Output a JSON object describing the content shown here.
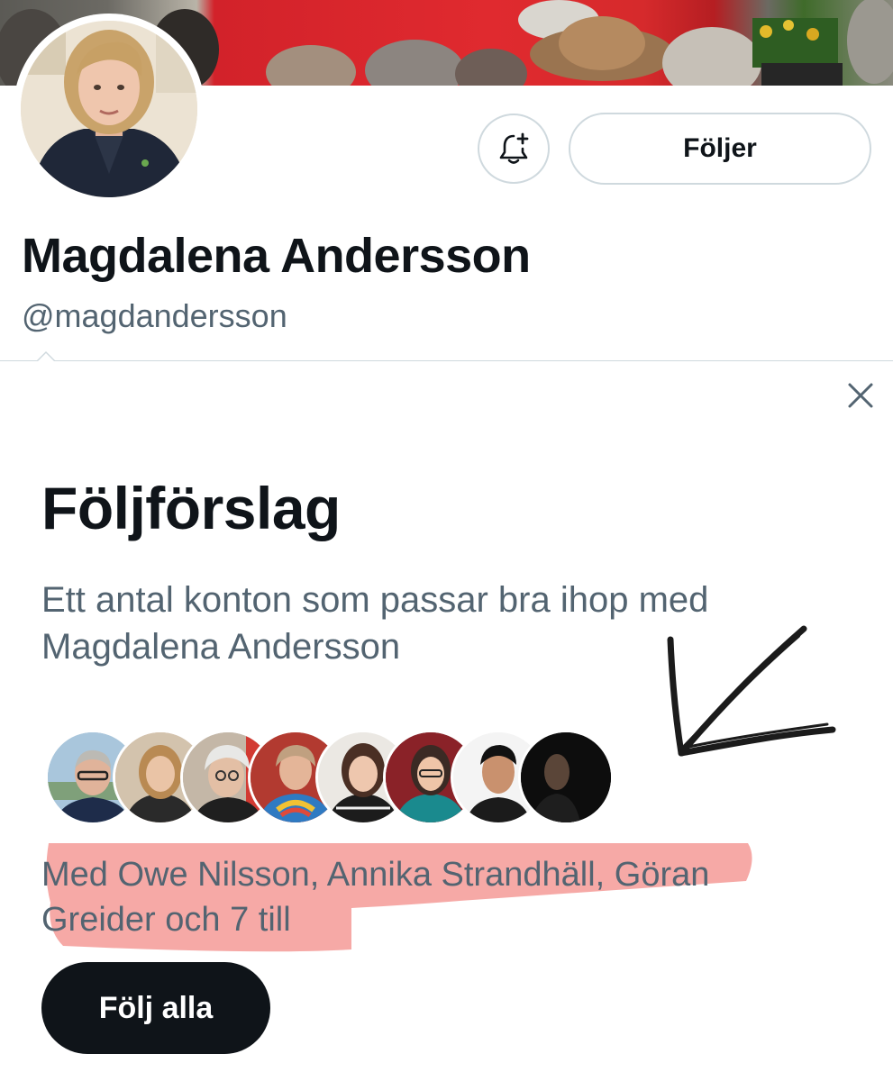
{
  "profile": {
    "name": "Magdalena Andersson",
    "handle": "@magdandersson",
    "follow_state_label": "Följer"
  },
  "icons": {
    "notifications": "bell-plus-icon",
    "close": "close-icon"
  },
  "suggestions": {
    "title": "Följförslag",
    "description": "Ett antal konton som passar bra ihop med Magdalena Andersson",
    "mutuals_text": "Med Owe Nilsson, Annika Strandhäll, Göran Greider och 7 till",
    "follow_all_label": "Följ alla",
    "avatar_count": 8
  },
  "colors": {
    "text_primary": "#0f1419",
    "text_secondary": "#536471",
    "border": "#cfd9de",
    "highlight": "#f59a96",
    "button_dark": "#0f1419"
  }
}
